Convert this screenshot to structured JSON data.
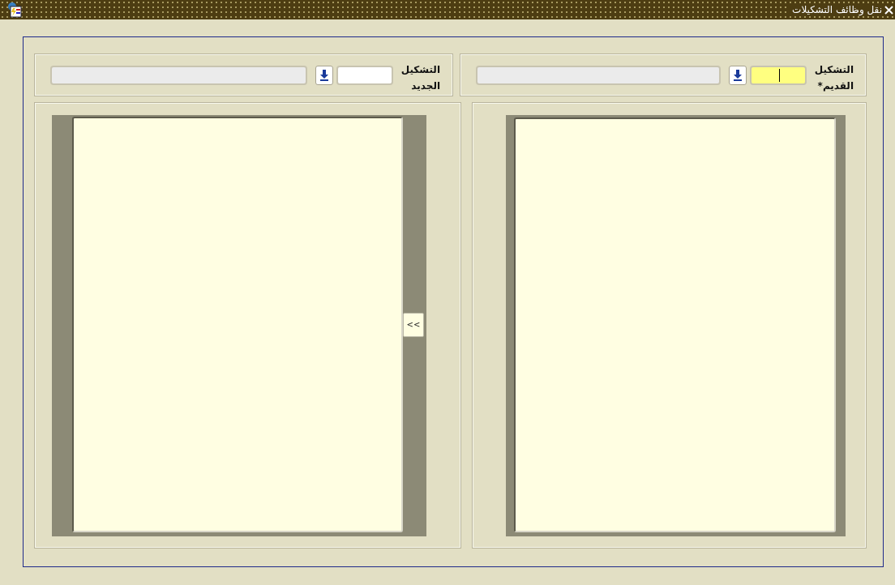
{
  "window": {
    "title": "نقل وظائف التشكيلات"
  },
  "fields": [
    {
      "label": "التشكيل القديم*",
      "required": true,
      "focused": true
    },
    {
      "label": "التشكيل الجديد",
      "required": false,
      "focused": false
    }
  ],
  "lists": [
    {
      "kind": "plain"
    },
    {
      "kind": "transfer",
      "button": "<<"
    }
  ]
}
